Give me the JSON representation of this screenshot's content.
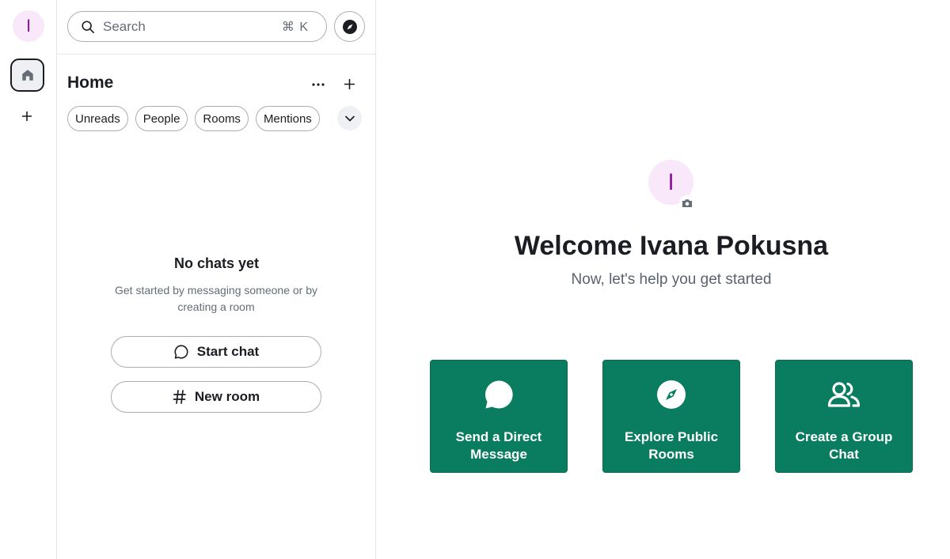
{
  "user": {
    "initial": "I",
    "name": "Ivana Pokusna"
  },
  "search": {
    "placeholder": "Search",
    "shortcut": "⌘ K"
  },
  "home": {
    "title": "Home"
  },
  "filters": [
    "Unreads",
    "People",
    "Rooms",
    "Mentions"
  ],
  "empty_state": {
    "title": "No chats yet",
    "description": "Get started by messaging someone or by creating a room",
    "start_chat": "Start chat",
    "new_room": "New room"
  },
  "welcome": {
    "title": "Welcome Ivana Pokusna",
    "subtitle": "Now, let's help you get started"
  },
  "actions": [
    {
      "label": "Send a Direct Message",
      "icon": "message-bubble-icon"
    },
    {
      "label": "Explore Public Rooms",
      "icon": "compass-icon"
    },
    {
      "label": "Create a Group Chat",
      "icon": "group-icon"
    }
  ],
  "colors": {
    "accent": "#0a7c5f",
    "avatar_bg": "#f9e7fa",
    "avatar_fg": "#8d1aa0"
  }
}
